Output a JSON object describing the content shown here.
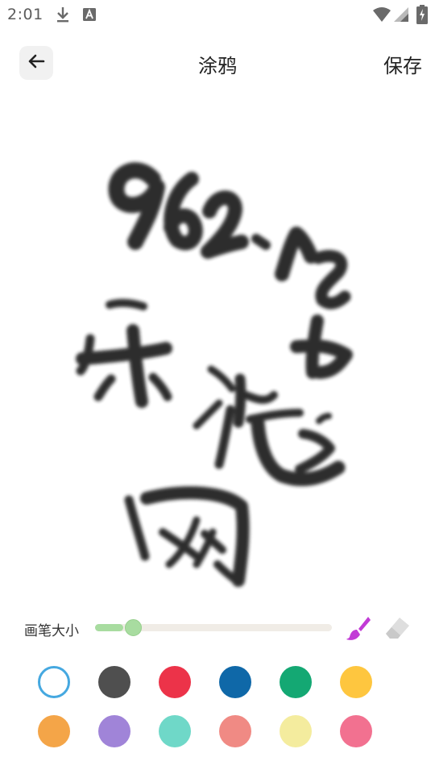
{
  "status_bar": {
    "time": "2:01",
    "icons": [
      "download-icon",
      "font-app-icon",
      "wifi-icon",
      "signal-icon",
      "battery-charging-icon"
    ]
  },
  "app_bar": {
    "back_icon": "arrow-left-icon",
    "title": "涂鸦",
    "save_label": "保存"
  },
  "canvas": {
    "stroke_color": "#1a1a1a",
    "handwriting": [
      "962",
      ".",
      "ne",
      "t",
      "乐",
      "游",
      "网"
    ]
  },
  "brush": {
    "label": "画笔大小",
    "size_fraction": 0.1,
    "active_tool": "brush",
    "brush_icon": "paint-brush-icon",
    "eraser_icon": "eraser-icon",
    "brush_icon_color": "#c23bd6",
    "eraser_icon_color": "#d8d8d8"
  },
  "palette": {
    "selected_index": 0,
    "colors": [
      "#ffffff",
      "#4f4f4f",
      "#ec3349",
      "#0f68a8",
      "#14a873",
      "#fec63f",
      "#f4a548",
      "#a084d8",
      "#6fd8c8",
      "#f08a84",
      "#f4ec9e",
      "#f27190"
    ]
  }
}
